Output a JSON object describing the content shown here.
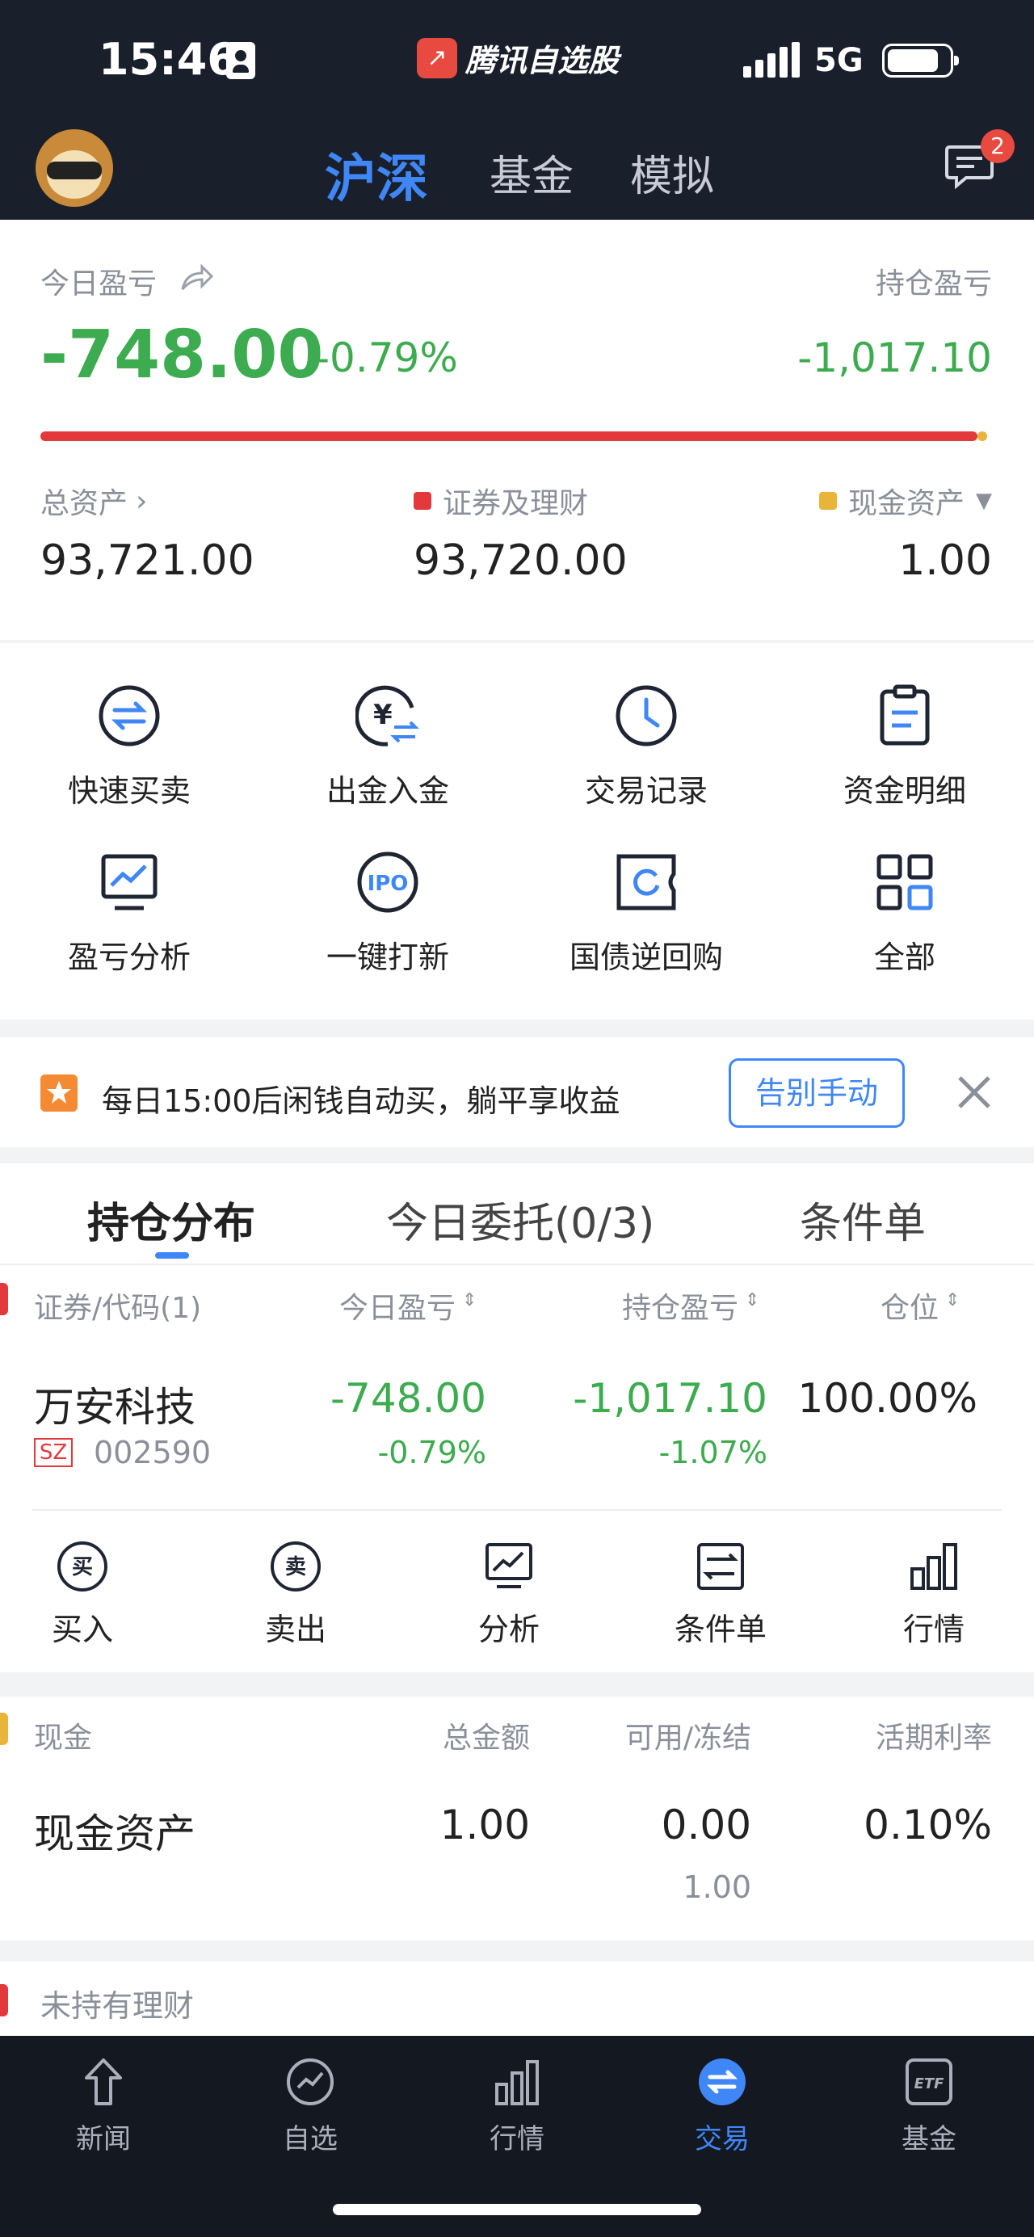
{
  "status_bar": {
    "time": "15:46",
    "network": "5G",
    "app_name": "腾讯自选股"
  },
  "header": {
    "tabs": [
      {
        "label": "沪深"
      },
      {
        "label": "基金"
      },
      {
        "label": "模拟"
      }
    ],
    "active_tab": "沪深",
    "message_badge": "2"
  },
  "summary": {
    "today_pnl_label": "今日盈亏",
    "hold_pnl_label": "持仓盈亏",
    "today_pnl": "-748.00",
    "today_pnl_pct": "-0.79%",
    "hold_pnl": "-1,017.10",
    "securities_share": 0.99999,
    "total_assets_label": "总资产",
    "securities_label": "证券及理财",
    "cash_label": "现金资产",
    "total_assets": "93,721.00",
    "securities": "93,720.00",
    "cash": "1.00"
  },
  "quick_grid": [
    {
      "label": "快速买卖",
      "icon": "swap-icon"
    },
    {
      "label": "出金入金",
      "icon": "yuan-transfer-icon"
    },
    {
      "label": "交易记录",
      "icon": "clock-icon"
    },
    {
      "label": "资金明细",
      "icon": "clipboard-icon"
    },
    {
      "label": "盈亏分析",
      "icon": "chart-monitor-icon"
    },
    {
      "label": "一键打新",
      "icon": "ipo-icon"
    },
    {
      "label": "国债逆回购",
      "icon": "ticket-refresh-icon"
    },
    {
      "label": "全部",
      "icon": "grid-icon"
    }
  ],
  "banner": {
    "text": "每日15:00后闲钱自动买，躺平享收益",
    "button": "告别手动"
  },
  "holdings": {
    "tabs": [
      {
        "label": "持仓分布"
      },
      {
        "label": "今日委托(0/3)"
      },
      {
        "label": "条件单"
      }
    ],
    "columns": {
      "security": "证券/代码(1)",
      "today_pnl": "今日盈亏",
      "hold_pnl": "持仓盈亏",
      "position": "仓位"
    },
    "row": {
      "name": "万安科技",
      "market": "SZ",
      "code": "002590",
      "today_pnl": "-748.00",
      "today_pnl_pct": "-0.79%",
      "hold_pnl": "-1,017.10",
      "hold_pnl_pct": "-1.07%",
      "position": "100.00%"
    },
    "actions": [
      {
        "label": "买入",
        "icon": "buy-icon",
        "glyph": "买"
      },
      {
        "label": "卖出",
        "icon": "sell-icon",
        "glyph": "卖"
      },
      {
        "label": "分析",
        "icon": "analysis-icon"
      },
      {
        "label": "条件单",
        "icon": "condition-order-icon"
      },
      {
        "label": "行情",
        "icon": "market-icon"
      }
    ]
  },
  "cash": {
    "section_label": "现金",
    "columns": {
      "total": "总金额",
      "available": "可用/冻结",
      "rate": "活期利率"
    },
    "row": {
      "name": "现金资产",
      "total": "1.00",
      "available": "0.00",
      "frozen": "1.00",
      "rate": "0.10%"
    }
  },
  "not_held": {
    "label": "未持有理财"
  },
  "bottom_nav": [
    {
      "label": "新闻",
      "icon": "news-icon"
    },
    {
      "label": "自选",
      "icon": "watchlist-icon"
    },
    {
      "label": "行情",
      "icon": "bar-chart-icon"
    },
    {
      "label": "交易",
      "icon": "trade-icon"
    },
    {
      "label": "基金",
      "icon": "etf-icon"
    }
  ],
  "bottom_nav_active": "交易",
  "colors": {
    "accent": "#3f86f7",
    "loss": "#3dab4f",
    "header_bg": "#1a1f2c",
    "bar": "#e4393c",
    "cash_dot": "#e8b43a"
  }
}
